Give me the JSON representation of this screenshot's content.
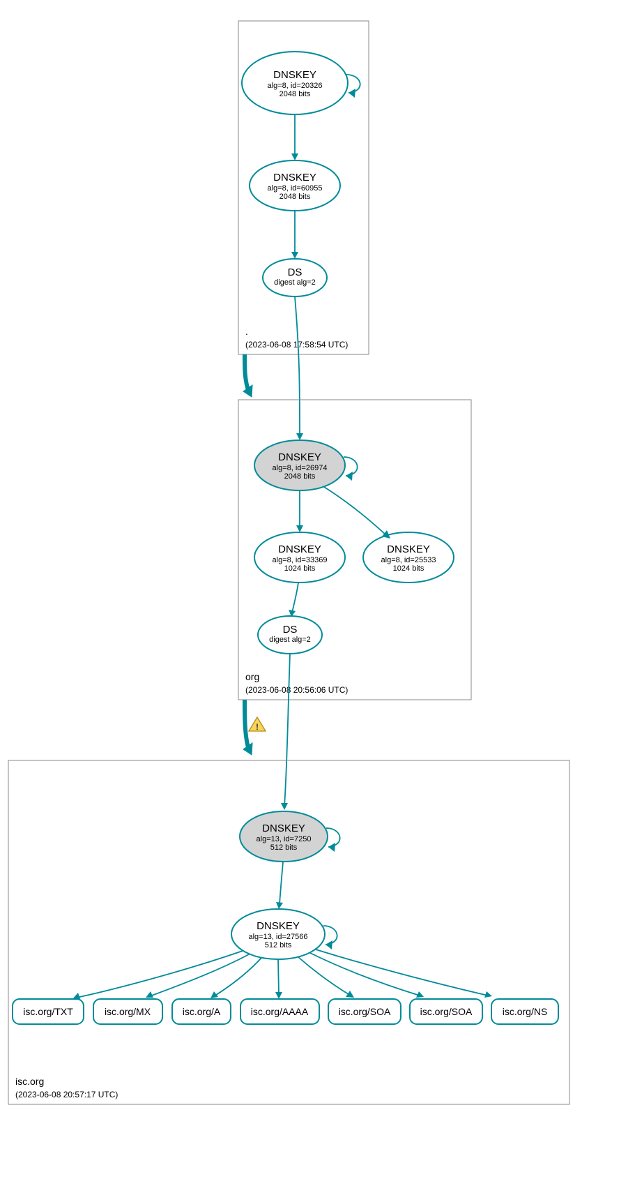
{
  "zones": {
    "root": {
      "label": ".",
      "timestamp": "(2023-06-08 17:58:54 UTC)"
    },
    "org": {
      "label": "org",
      "timestamp": "(2023-06-08 20:56:06 UTC)"
    },
    "isc": {
      "label": "isc.org",
      "timestamp": "(2023-06-08 20:57:17 UTC)"
    }
  },
  "nodes": {
    "root_ksk": {
      "title": "DNSKEY",
      "line1": "alg=8, id=20326",
      "line2": "2048 bits"
    },
    "root_zsk": {
      "title": "DNSKEY",
      "line1": "alg=8, id=60955",
      "line2": "2048 bits"
    },
    "root_ds": {
      "title": "DS",
      "line1": "digest alg=2"
    },
    "org_ksk": {
      "title": "DNSKEY",
      "line1": "alg=8, id=26974",
      "line2": "2048 bits"
    },
    "org_zsk": {
      "title": "DNSKEY",
      "line1": "alg=8, id=33369",
      "line2": "1024 bits"
    },
    "org_zsk2": {
      "title": "DNSKEY",
      "line1": "alg=8, id=25533",
      "line2": "1024 bits"
    },
    "org_ds": {
      "title": "DS",
      "line1": "digest alg=2"
    },
    "isc_ksk": {
      "title": "DNSKEY",
      "line1": "alg=13, id=7250",
      "line2": "512 bits"
    },
    "isc_zsk": {
      "title": "DNSKEY",
      "line1": "alg=13, id=27566",
      "line2": "512 bits"
    }
  },
  "records": {
    "txt": "isc.org/TXT",
    "mx": "isc.org/MX",
    "a": "isc.org/A",
    "aaaa": "isc.org/AAAA",
    "soa1": "isc.org/SOA",
    "soa2": "isc.org/SOA",
    "ns": "isc.org/NS"
  },
  "warning": "!"
}
